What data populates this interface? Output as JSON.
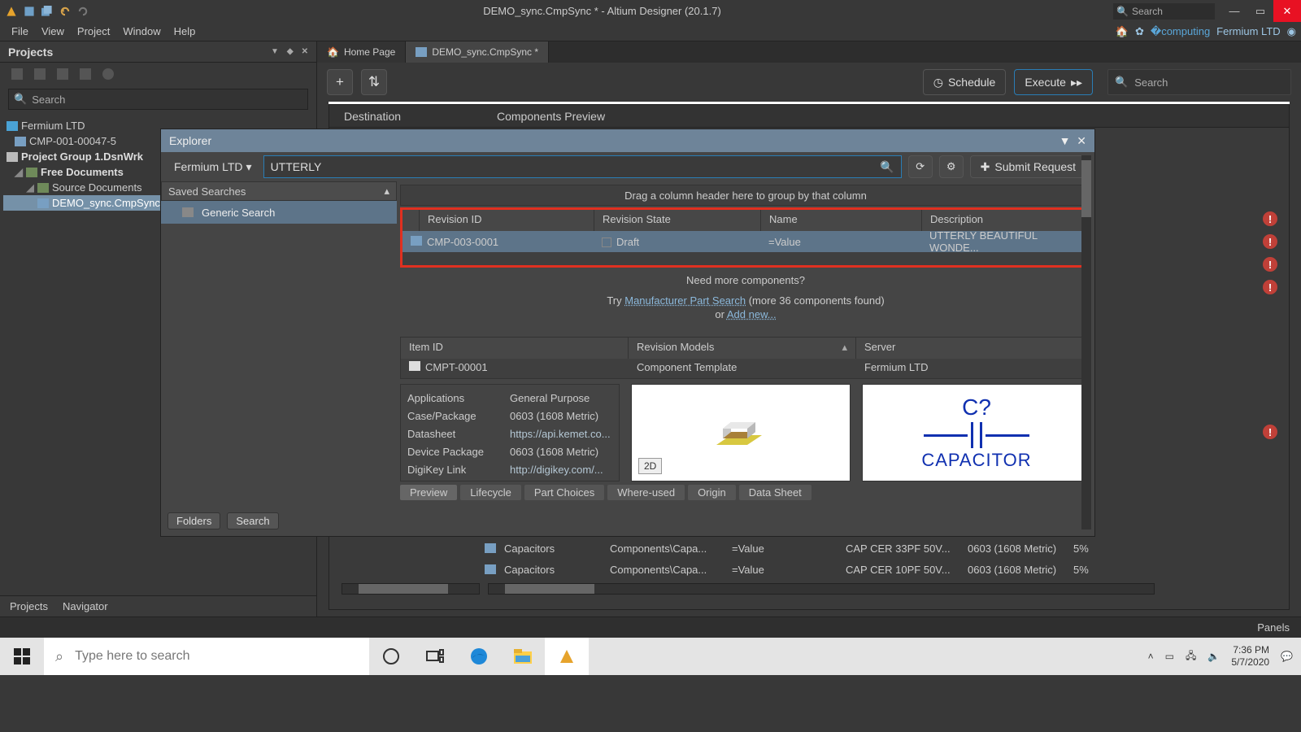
{
  "titlebar": {
    "title": "DEMO_sync.CmpSync * - Altium Designer (20.1.7)",
    "search_placeholder": "Search"
  },
  "menubar": {
    "items": [
      "File",
      "View",
      "Project",
      "Window",
      "Help"
    ],
    "workspace": "Fermium LTD"
  },
  "projects": {
    "title": "Projects",
    "search_placeholder": "Search",
    "tree": {
      "workspace": "Fermium LTD",
      "cmp": "CMP-001-00047-5",
      "group": "Project Group 1.DsnWrk",
      "free_docs": "Free Documents",
      "source_docs": "Source Documents",
      "active_doc": "DEMO_sync.CmpSync *"
    },
    "footer_tabs": [
      "Projects",
      "Navigator"
    ]
  },
  "docs": {
    "tabs": [
      "Home Page",
      "DEMO_sync.CmpSync *"
    ]
  },
  "toolbar": {
    "schedule": "Schedule",
    "execute": "Execute",
    "search_placeholder": "Search"
  },
  "content_header": {
    "dest": "Destination",
    "preview": "Components Preview"
  },
  "explorer": {
    "title": "Explorer",
    "workspace": "Fermium LTD",
    "search_value": "UTTERLY",
    "submit": "Submit Request",
    "saved_label": "Saved Searches",
    "saved_item": "Generic Search",
    "left_tabs": [
      "Folders",
      "Search"
    ],
    "drag_hint": "Drag a column header here to group by that column",
    "grid_head": {
      "rev": "Revision ID",
      "state": "Revision State",
      "name": "Name",
      "desc": "Description"
    },
    "grid_row": {
      "rev": "CMP-003-0001",
      "state": "Draft",
      "name": "=Value",
      "desc": "UTTERLY BEAUTIFUL WONDE..."
    },
    "need_more": "Need more components?",
    "try_prefix": "Try ",
    "mps": "Manufacturer Part Search",
    "more_found": " (more 36 components found)",
    "or": "or ",
    "add_new": "Add new...",
    "sg_head": {
      "item": "Item ID",
      "mod": "Revision Models",
      "srv": "Server"
    },
    "sg_row": {
      "item": "CMPT-00001",
      "mod": "Component Template",
      "srv": "Fermium LTD"
    },
    "props": [
      {
        "l": "Applications",
        "v": "General Purpose"
      },
      {
        "l": "Case/Package",
        "v": "0603 (1608 Metric)"
      },
      {
        "l": "Datasheet",
        "v": "https://api.kemet.co..."
      },
      {
        "l": "Device Package",
        "v": "0603 (1608 Metric)"
      },
      {
        "l": "DigiKey Link",
        "v": "http://digikey.com/..."
      }
    ],
    "preview_tag": "2D",
    "symb_ref": "C?",
    "symb_name": "CAPACITOR",
    "detail_tabs": [
      "Preview",
      "Lifecycle",
      "Part Choices",
      "Where-used",
      "Origin",
      "Data Sheet"
    ]
  },
  "under_rows": [
    {
      "a": "Capacitors",
      "b": "Components\\Capa...",
      "c": "=Value",
      "d": "CAP CER 33PF 50V...",
      "e": "0603 (1608 Metric)",
      "f": "5%"
    },
    {
      "a": "Capacitors",
      "b": "Components\\Capa...",
      "c": "=Value",
      "d": "CAP CER 10PF 50V...",
      "e": "0603 (1608 Metric)",
      "f": "5%"
    }
  ],
  "footer": {
    "panels": "Panels"
  },
  "taskbar": {
    "search_placeholder": "Type here to search",
    "time": "7:36 PM",
    "date": "5/7/2020"
  }
}
